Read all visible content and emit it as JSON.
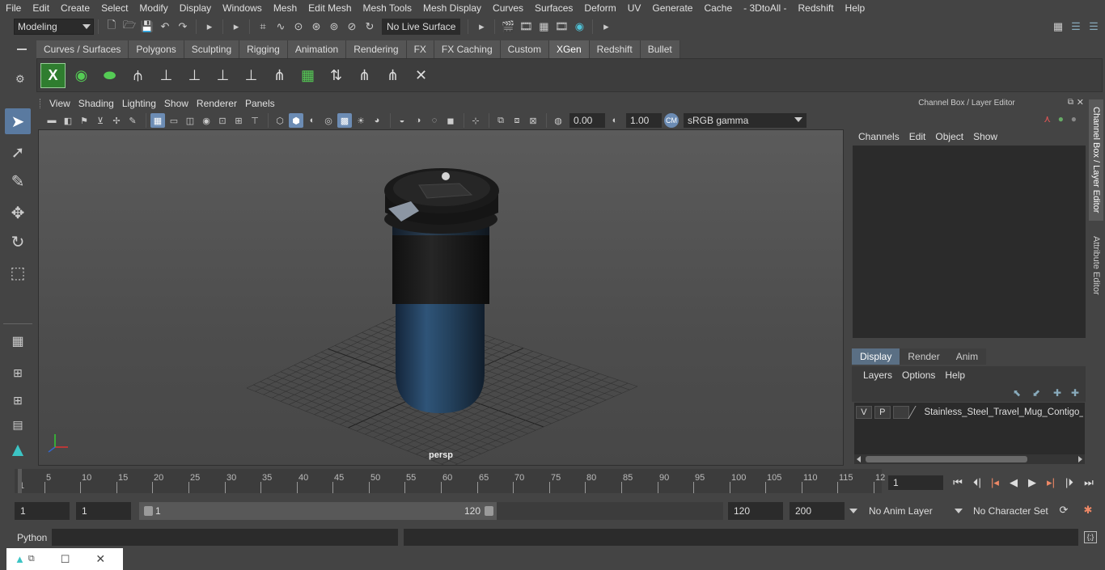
{
  "menubar": [
    "File",
    "Edit",
    "Create",
    "Select",
    "Modify",
    "Display",
    "Windows",
    "Mesh",
    "Edit Mesh",
    "Mesh Tools",
    "Mesh Display",
    "Curves",
    "Surfaces",
    "Deform",
    "UV",
    "Generate",
    "Cache",
    "- 3DtoAll -",
    "Redshift",
    "Help"
  ],
  "status": {
    "mode": "Modeling",
    "live_surface": "No Live Surface"
  },
  "shelf_tabs": [
    "Curves / Surfaces",
    "Polygons",
    "Sculpting",
    "Rigging",
    "Animation",
    "Rendering",
    "FX",
    "FX Caching",
    "Custom",
    "XGen",
    "Redshift",
    "Bullet"
  ],
  "shelf_active": "XGen",
  "viewport": {
    "menu": [
      "View",
      "Shading",
      "Lighting",
      "Show",
      "Renderer",
      "Panels"
    ],
    "exposure": "0.00",
    "gamma": "1.00",
    "colorspace": "sRGB gamma",
    "camera_label": "persp"
  },
  "channel_box": {
    "title": "Channel Box / Layer Editor",
    "menu": [
      "Channels",
      "Edit",
      "Object",
      "Show"
    ]
  },
  "layer_editor": {
    "tabs": [
      "Display",
      "Render",
      "Anim"
    ],
    "active_tab": "Display",
    "menu": [
      "Layers",
      "Options",
      "Help"
    ],
    "layer": {
      "v": "V",
      "p": "P",
      "name": "Stainless_Steel_Travel_Mug_Contigo_"
    }
  },
  "side_tabs": [
    "Channel Box / Layer Editor",
    "Attribute Editor"
  ],
  "timeline": {
    "ticks": [
      "5",
      "10",
      "15",
      "20",
      "25",
      "30",
      "35",
      "40",
      "45",
      "50",
      "55",
      "60",
      "65",
      "70",
      "75",
      "80",
      "85",
      "90",
      "95",
      "100",
      "105",
      "110",
      "115",
      "12"
    ],
    "start_label": "1",
    "current_frame": "1"
  },
  "range": {
    "start": "1",
    "playback_start": "1",
    "slider_start": "1",
    "slider_end": "120",
    "playback_end": "120",
    "end": "200",
    "anim_layer": "No Anim Layer",
    "char_set": "No Character Set"
  },
  "cmdline": {
    "label": "Python"
  }
}
